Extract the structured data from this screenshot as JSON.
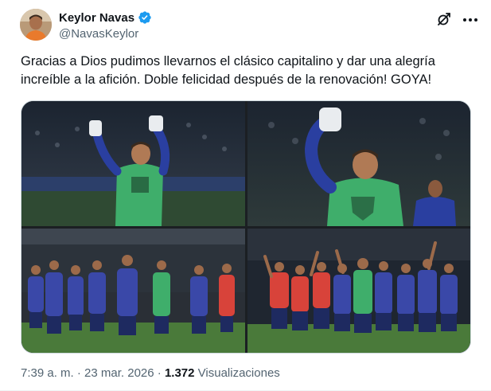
{
  "author": {
    "display_name": "Keylor Navas",
    "handle": "@NavasKeylor",
    "verified": true,
    "verified_color": "#1d9bf0"
  },
  "tweet": {
    "text": "Gracias a Dios pudimos llevarnos el clásico capitalino y dar una alegría increíble a la afición. Doble felicidad después de la renovación! GOYA!"
  },
  "media": {
    "photo_count": 4
  },
  "meta": {
    "time": "7:39 a. m.",
    "separator": "·",
    "date": "23 mar. 2026",
    "views_count": "1.372",
    "views_label": "Visualizaciones"
  },
  "icons": [
    "grok-icon",
    "more-icon",
    "verified-badge-icon"
  ],
  "colors": {
    "text_primary": "#0f1419",
    "text_secondary": "#536471",
    "pumas_green": "#3fae6b",
    "pumas_navy": "#1f2a6b"
  }
}
